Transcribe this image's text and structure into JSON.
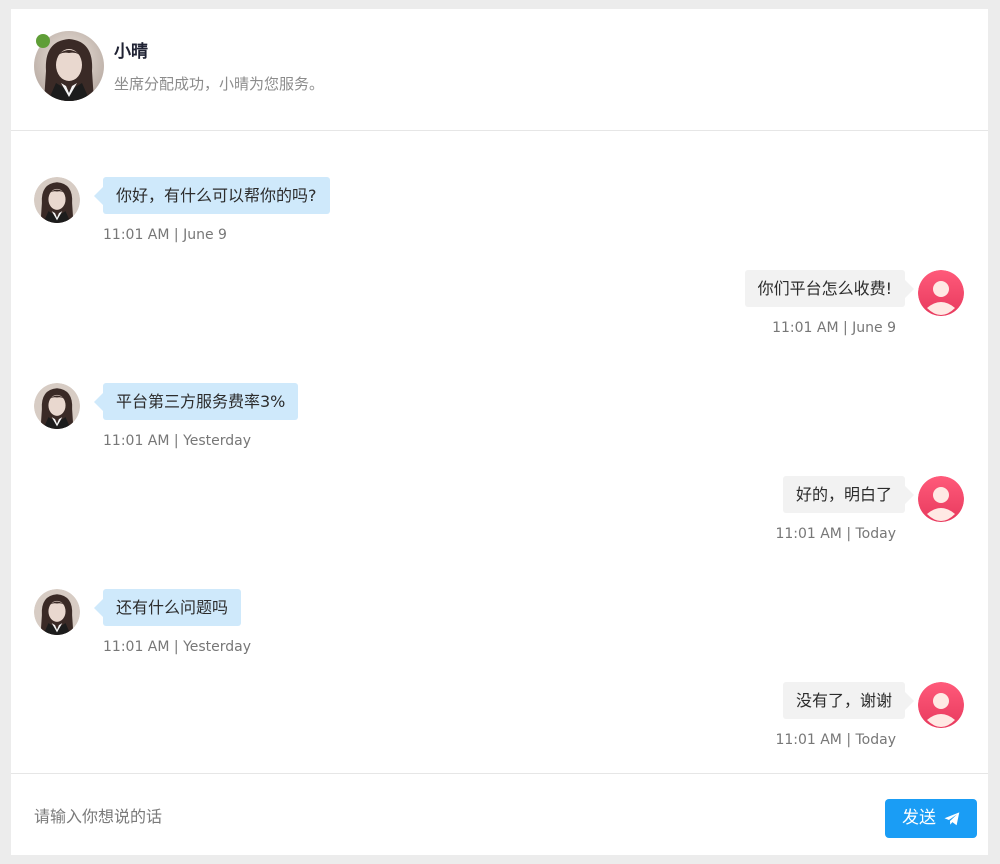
{
  "header": {
    "agent_name": "小晴",
    "status": "坐席分配成功，小晴为您服务。",
    "online_color": "#5f9e37"
  },
  "messages": [
    {
      "side": "agent",
      "text": "你好，有什么可以帮你的吗?",
      "meta": "11:01 AM | June 9"
    },
    {
      "side": "user",
      "text": "你们平台怎么收费!",
      "meta": "11:01 AM | June 9"
    },
    {
      "side": "agent",
      "text": "平台第三方服务费率3%",
      "meta": "11:01 AM | Yesterday"
    },
    {
      "side": "user",
      "text": "好的，明白了",
      "meta": "11:01 AM | Today"
    },
    {
      "side": "agent",
      "text": "还有什么问题吗",
      "meta": "11:01 AM | Yesterday"
    },
    {
      "side": "user",
      "text": "没有了，谢谢",
      "meta": "11:01 AM | Today"
    }
  ],
  "composer": {
    "placeholder": "请输入你想说的话",
    "value": "",
    "send_label": "发送",
    "send_icon": "paper-plane-icon",
    "accent": "#1a9df5"
  },
  "colors": {
    "agent_bubble": "#cfe9fb",
    "user_bubble": "#f2f2f2",
    "user_avatar": "#f0486b"
  }
}
